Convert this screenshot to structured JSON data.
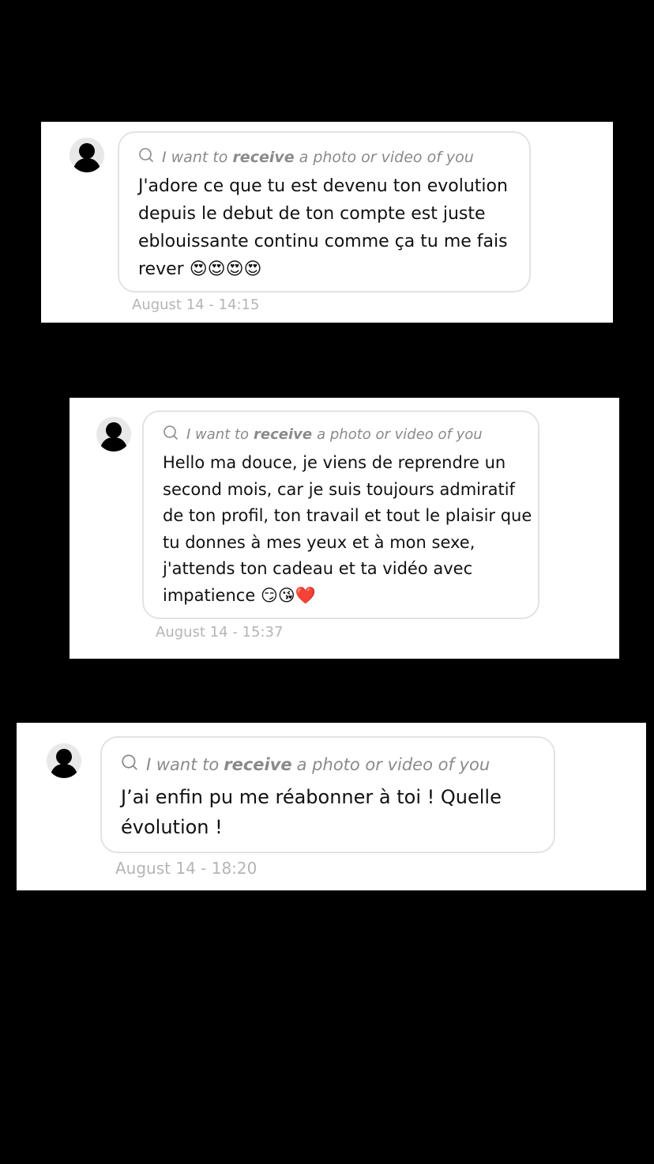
{
  "request": {
    "prefix": "I want to",
    "keyword": "receive",
    "suffix": "a photo or video of you"
  },
  "messages": [
    {
      "text": "J'adore ce que tu est devenu ton evolution depuis le debut de ton compte est juste eblouissante continu comme ça tu me fais rever",
      "emoji": "😍😍😍😍",
      "time": "August 14 - 14:15"
    },
    {
      "text": "Hello ma douce, je viens de reprendre un second mois, car je suis toujours admiratif de ton profil, ton travail et tout le plaisir que tu donnes à mes yeux et à mon sexe, j'attends ton cadeau et ta vidéo avec impatience",
      "emoji": "😏😘❤️",
      "time": "August 14 - 15:37"
    },
    {
      "text": "J’ai enfin pu me réabonner à toi ! Quelle évolution !",
      "emoji": "",
      "time": "August 14 - 18:20"
    }
  ],
  "icons": {
    "avatar": "default-avatar-silhouette",
    "request": "chat-bubble-icon"
  },
  "colors": {
    "background": "#000000",
    "card": "#ffffff",
    "bubble_border": "#e3e3e3",
    "request_text": "#8a8a8a",
    "message_text": "#111111",
    "timestamp": "#b5b5b5"
  }
}
